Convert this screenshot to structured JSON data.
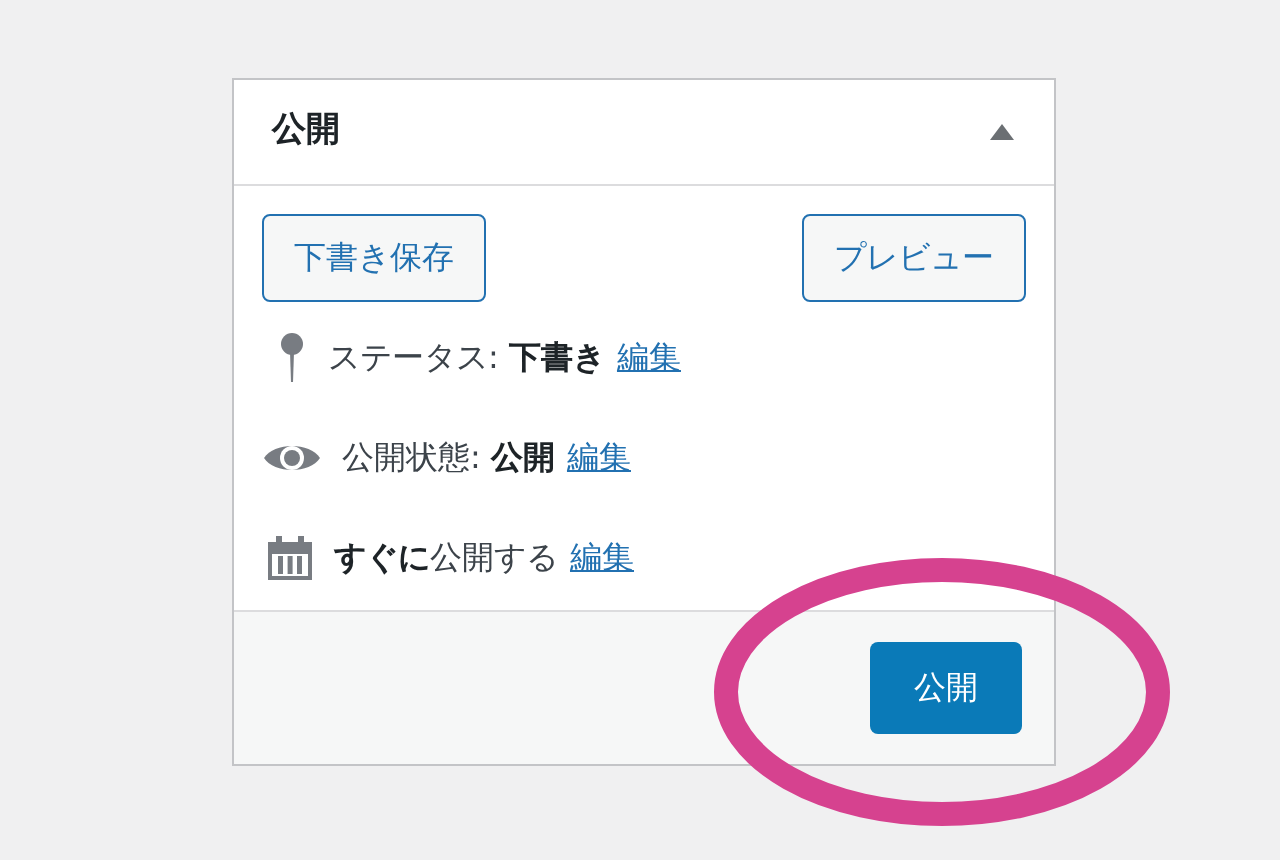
{
  "panel": {
    "title": "公開",
    "expanded": true
  },
  "buttons": [
    "下書き保存",
    "プレビュー"
  ],
  "rows": [
    {
      "kind": "status",
      "text": "ステータス: **下書き**",
      "link": "編集"
    },
    {
      "kind": "visibility",
      "text": "公開状態: **公開**",
      "link": "編集"
    },
    {
      "kind": "schedule",
      "text": "**すぐに**公開する",
      "link": "編集"
    }
  ],
  "publish_button": "公開"
}
